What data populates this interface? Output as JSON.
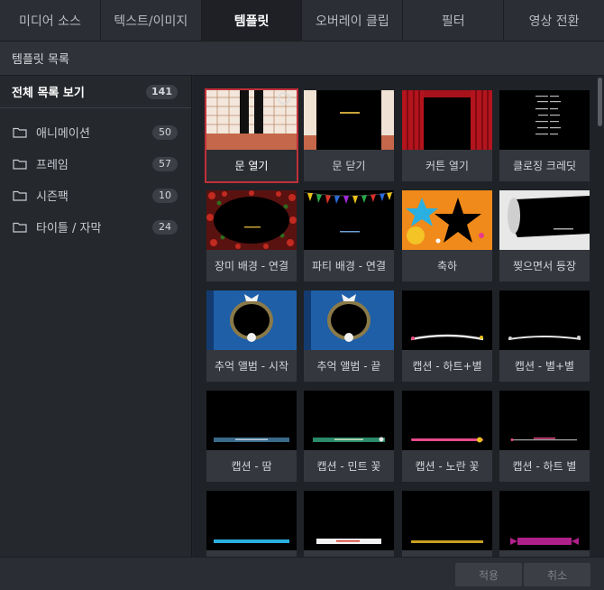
{
  "tabs": [
    {
      "label": "미디어 소스"
    },
    {
      "label": "텍스트/이미지"
    },
    {
      "label": "템플릿"
    },
    {
      "label": "오버레이 클립"
    },
    {
      "label": "필터"
    },
    {
      "label": "영상 전환"
    }
  ],
  "active_tab": "템플릿",
  "section_title": "템플릿 목록",
  "sidebar": {
    "all": {
      "label": "전체 목록 보기",
      "count": "141"
    },
    "items": [
      {
        "label": "애니메이션",
        "count": "50",
        "icon": "folder-icon"
      },
      {
        "label": "프레임",
        "count": "57",
        "icon": "folder-icon"
      },
      {
        "label": "시즌팩",
        "count": "10",
        "icon": "folder-icon"
      },
      {
        "label": "타이틀 / 자막",
        "count": "24",
        "icon": "folder-icon"
      }
    ]
  },
  "templates": [
    {
      "label": "문 열기"
    },
    {
      "label": "문 닫기"
    },
    {
      "label": "커튼 열기"
    },
    {
      "label": "클로징 크레딧"
    },
    {
      "label": "장미 배경 - 연결"
    },
    {
      "label": "파티 배경 - 연결"
    },
    {
      "label": "축하"
    },
    {
      "label": "찢으면서 등장"
    },
    {
      "label": "추억 앨범 - 시작"
    },
    {
      "label": "추억 앨범 - 끝"
    },
    {
      "label": "캡션 - 하트+별"
    },
    {
      "label": "캡션 - 별+별"
    },
    {
      "label": "캡션 - 땀"
    },
    {
      "label": "캡션 - 민트 꽃"
    },
    {
      "label": "캡션 - 노란 꽃"
    },
    {
      "label": "캡션 - 하트 별"
    },
    {
      "label": ""
    },
    {
      "label": ""
    },
    {
      "label": ""
    },
    {
      "label": ""
    }
  ],
  "footer": {
    "apply_label": "적용",
    "cancel_label": "취소"
  },
  "colors": {
    "accent": "#c0313a",
    "bg": "#22252b",
    "tile": "#34373d"
  }
}
